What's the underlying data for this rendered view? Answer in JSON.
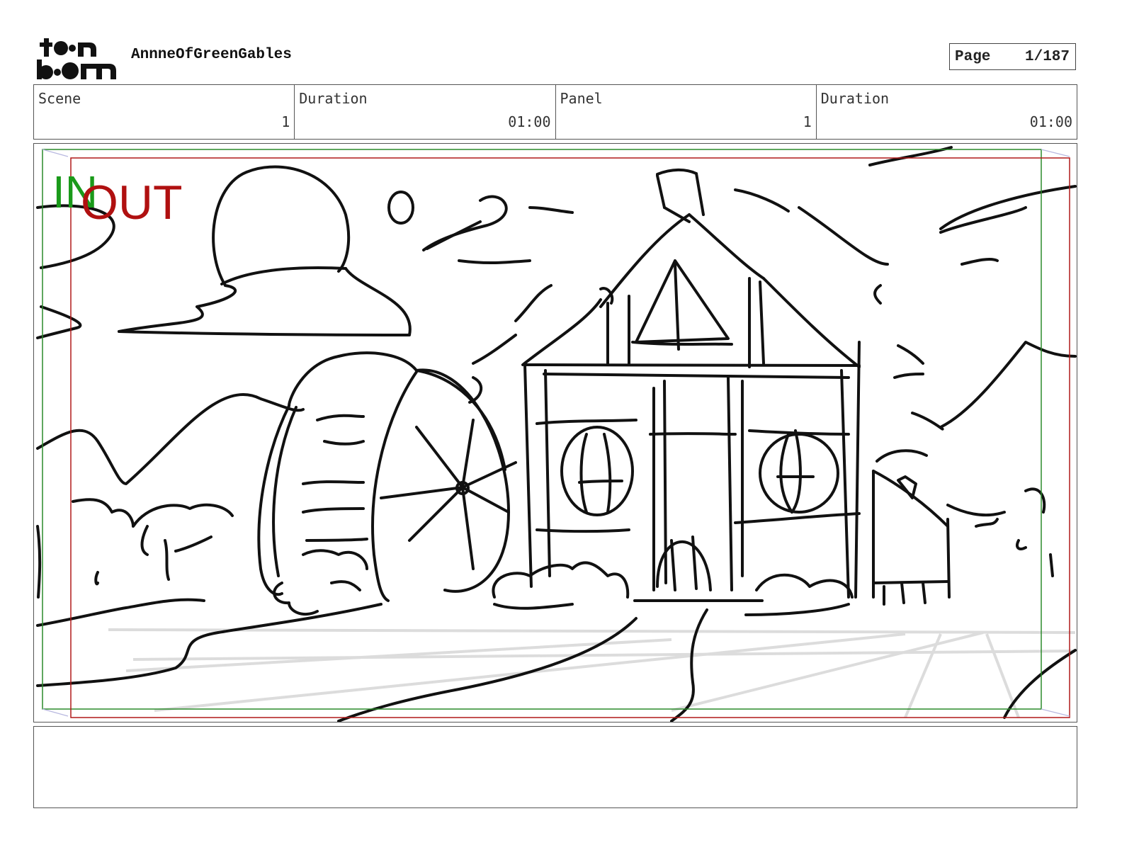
{
  "header": {
    "logo_top": "toon",
    "logo_bottom": "boom",
    "project_title": "AnnneOfGreenGables",
    "page_label": "Page",
    "page_value": "1/187"
  },
  "info": {
    "scene_label": "Scene",
    "scene_value": "1",
    "scene_duration_label": "Duration",
    "scene_duration_value": "01:00",
    "panel_label": "Panel",
    "panel_value": "1",
    "panel_duration_label": "Duration",
    "panel_duration_value": "01:00"
  },
  "panel": {
    "in_label": "IN",
    "out_label": "OUT",
    "in_color": "#1a9a1a",
    "out_color": "#b01010"
  },
  "notes": {
    "text": ""
  }
}
